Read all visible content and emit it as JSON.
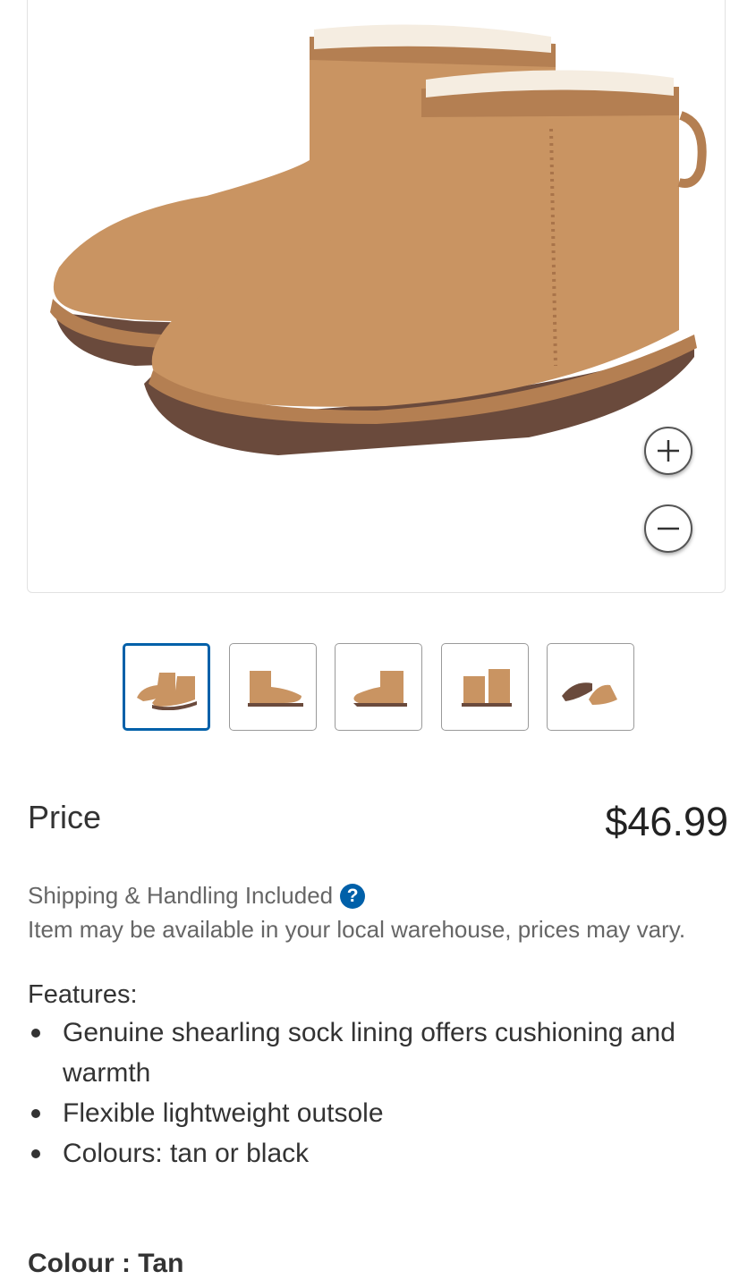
{
  "gallery": {
    "main_image_alt": "Tan shearling mini boots",
    "zoom_in_icon": "plus-icon",
    "zoom_out_icon": "minus-icon",
    "thumbnails": [
      {
        "alt": "Boots pair angled view",
        "selected": true
      },
      {
        "alt": "Single boot side view",
        "selected": false
      },
      {
        "alt": "Single boot profile view",
        "selected": false
      },
      {
        "alt": "Boots pair back view",
        "selected": false
      },
      {
        "alt": "Boots sole view",
        "selected": false
      }
    ]
  },
  "price": {
    "label": "Price",
    "value": "$46.99"
  },
  "shipping": {
    "text": "Shipping & Handling Included",
    "help_icon": "?",
    "availability": "Item may be available in your local warehouse, prices may vary."
  },
  "features": {
    "title": "Features:",
    "items": [
      "Genuine shearling sock lining offers cushioning and warmth",
      "Flexible lightweight outsole",
      "Colours: tan or black"
    ]
  },
  "colour": {
    "label": "Colour : Tan"
  },
  "colors": {
    "accent": "#0060a9",
    "boot": "#c99462",
    "sole": "#6a4a3c"
  }
}
